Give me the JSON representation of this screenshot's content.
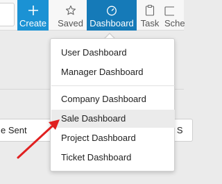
{
  "toolbar": {
    "create_label": "Create",
    "saved_label": "Saved",
    "dashboard_label": "Dashboard",
    "task_label": "Task",
    "schedule_label_partial": "Sche"
  },
  "background": {
    "left_tab_partial": "e Sent",
    "right_tab_partial": "e S"
  },
  "dropdown": {
    "items": [
      {
        "label": "User Dashboard"
      },
      {
        "label": "Manager Dashboard"
      },
      {
        "label": "Company Dashboard"
      },
      {
        "label": "Sale Dashboard"
      },
      {
        "label": "Project Dashboard"
      },
      {
        "label": "Ticket Dashboard"
      }
    ],
    "active_item": "Sale Dashboard"
  },
  "colors": {
    "create_bg": "#1b92d4",
    "dashboard_bg": "#157ab8",
    "annotation_arrow": "#e02020"
  },
  "icons": {
    "create": "plus-icon",
    "saved": "star-icon",
    "dashboard": "gauge-icon",
    "task": "clipboard-icon"
  }
}
